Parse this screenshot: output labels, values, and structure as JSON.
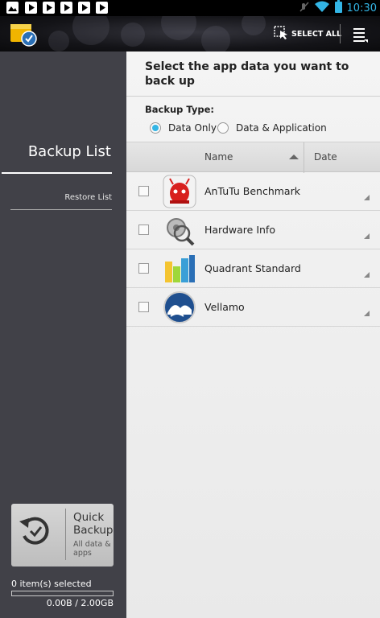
{
  "status_bar": {
    "notification_icons": [
      "image-icon",
      "play-store-icon",
      "play-store-icon",
      "play-store-icon",
      "play-store-icon",
      "play-store-icon"
    ],
    "system_icons": [
      "mute-icon",
      "wifi-icon",
      "battery-icon"
    ],
    "time": "10:30",
    "accent_color": "#33b5e5"
  },
  "action_bar": {
    "select_all_label": "SELECT ALL"
  },
  "sidebar": {
    "backup_list_label": "Backup List",
    "restore_list_label": "Restore List",
    "quick_backup": {
      "title": "Quick Backup",
      "subtitle": "All data & apps"
    },
    "selected_count": "0 item(s) selected",
    "storage_text": "0.00B / 2.00GB",
    "storage_used_fraction": 0
  },
  "main": {
    "heading": "Select the app data you want to back up",
    "backup_type_label": "Backup Type:",
    "options": [
      {
        "label": "Data Only",
        "selected": true
      },
      {
        "label": "Data & Application",
        "selected": false
      }
    ],
    "columns": {
      "name": "Name",
      "date": "Date"
    },
    "apps": [
      {
        "name": "AnTuTu Benchmark",
        "icon": "antutu-icon",
        "checked": false
      },
      {
        "name": "Hardware Info",
        "icon": "hardware-info-icon",
        "checked": false
      },
      {
        "name": "Quadrant Standard",
        "icon": "quadrant-icon",
        "checked": false
      },
      {
        "name": "Vellamo",
        "icon": "vellamo-icon",
        "checked": false
      }
    ]
  }
}
